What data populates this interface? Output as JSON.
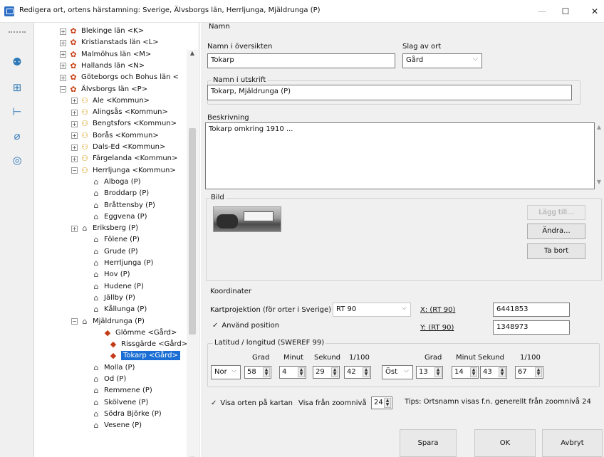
{
  "window": {
    "title": "Redigera ort, ortens härstamning: Sverige, Älvsborgs län, Herrljunga, Mjäldrunga (P)",
    "minimize_glyph": "—",
    "maximize_glyph": "☐",
    "close_glyph": "✕"
  },
  "toolbar": {
    "icons": [
      "people-icon",
      "tree-structure-icon",
      "hierarchy-icon",
      "filter-icon",
      "location-target-icon"
    ]
  },
  "tree": {
    "rows": [
      {
        "label": "Blekinge län <K>",
        "expander": "+",
        "icon": "✿"
      },
      {
        "label": "Kristianstads län <L>",
        "expander": "+",
        "icon": "✿"
      },
      {
        "label": "Malmöhus län <M>",
        "expander": "+",
        "icon": "✿"
      },
      {
        "label": "Hallands län <N>",
        "expander": "+",
        "icon": "✿"
      },
      {
        "label": "Göteborgs och Bohus län <",
        "expander": "+",
        "icon": "✿"
      },
      {
        "label": "Älvsborgs län <P>",
        "expander": "−",
        "icon": "✿"
      },
      {
        "label": "Ale <Kommun>",
        "expander": "+",
        "icon": "⚇"
      },
      {
        "label": "Alingsås <Kommun>",
        "expander": "+",
        "icon": "⚇"
      },
      {
        "label": "Bengtsfors <Kommun>",
        "expander": "+",
        "icon": "⚇"
      },
      {
        "label": "Borås <Kommun>",
        "expander": "+",
        "icon": "⚇"
      },
      {
        "label": "Dals-Ed <Kommun>",
        "expander": "+",
        "icon": "⚇"
      },
      {
        "label": "Färgelanda <Kommun>",
        "expander": "+",
        "icon": "⚇"
      },
      {
        "label": "Herrljunga <Kommun>",
        "expander": "−",
        "icon": "⚇"
      },
      {
        "label": "Alboga (P)",
        "expander": "",
        "icon": "⌂"
      },
      {
        "label": "Broddarp (P)",
        "expander": "",
        "icon": "⌂"
      },
      {
        "label": "Bråttensby (P)",
        "expander": "",
        "icon": "⌂"
      },
      {
        "label": "Eggvena (P)",
        "expander": "",
        "icon": "⌂"
      },
      {
        "label": "Eriksberg (P)",
        "expander": "+",
        "icon": "⌂"
      },
      {
        "label": "Fölene (P)",
        "expander": "",
        "icon": "⌂"
      },
      {
        "label": "Grude (P)",
        "expander": "",
        "icon": "⌂"
      },
      {
        "label": "Herrljunga (P)",
        "expander": "",
        "icon": "⌂"
      },
      {
        "label": "Hov (P)",
        "expander": "",
        "icon": "⌂"
      },
      {
        "label": "Hudene (P)",
        "expander": "",
        "icon": "⌂"
      },
      {
        "label": "Jällby (P)",
        "expander": "",
        "icon": "⌂"
      },
      {
        "label": "Kållunga (P)",
        "expander": "",
        "icon": "⌂"
      },
      {
        "label": "Mjäldrunga (P)",
        "expander": "−",
        "icon": "⌂"
      },
      {
        "label": "Glömme <Gård>",
        "expander": "",
        "icon": "◆"
      },
      {
        "label": "Rissgärde <Gård>",
        "expander": "",
        "icon": "◆"
      },
      {
        "label": "Tokarp <Gård>",
        "expander": "",
        "icon": "◆"
      },
      {
        "label": "Molla (P)",
        "expander": "",
        "icon": "⌂"
      },
      {
        "label": "Od (P)",
        "expander": "",
        "icon": "⌂"
      },
      {
        "label": "Remmene (P)",
        "expander": "",
        "icon": "⌂"
      },
      {
        "label": "Skölvene (P)",
        "expander": "",
        "icon": "⌂"
      },
      {
        "label": "Södra Björke (P)",
        "expander": "",
        "icon": "⌂"
      },
      {
        "label": "Vesene (P)",
        "expander": "",
        "icon": "⌂"
      }
    ],
    "scroll_up": "▲",
    "scroll_down": "▼",
    "scroll_left": "<",
    "scroll_right": ">"
  },
  "namn": {
    "group_label": "Namn",
    "oversikt_label": "Namn i översikten",
    "oversikt_value": "Tokarp",
    "slag_label": "Slag av ort",
    "slag_value": "Gård",
    "utskrift_label": "Namn i utskrift",
    "utskrift_value": "Tokarp, Mjäldrunga (P)"
  },
  "beskrivning": {
    "label": "Beskrivning",
    "value": "Tokarp omkring 1910 ..."
  },
  "bild": {
    "label": "Bild",
    "add_button": "Lägg till...",
    "change_button": "Ändra...",
    "remove_button": "Ta bort"
  },
  "koordinater": {
    "label": "Koordinater",
    "projection_label": "Kartprojektion (för orter i Sverige)",
    "projection_value": "RT 90",
    "use_position_mark": "✓",
    "use_position_label": "Använd position",
    "x_label": "X: (RT 90)",
    "x_value": "6441853",
    "y_label": "Y: (RT 90)",
    "y_value": "1348973",
    "latlong_label": "Latitud / longitud (SWEREF 99)",
    "headers_lat": [
      "Grad",
      "Minut",
      "Sekund",
      "1/100"
    ],
    "headers_lon": [
      "Grad",
      "Minut",
      "Sekund",
      "1/100"
    ],
    "lat_dir": "Nor",
    "lat_grad": "58",
    "lat_minut": "4",
    "lat_sekund": "29",
    "lat_hundra": "42",
    "lon_dir": "Öst",
    "lon_grad": "13",
    "lon_minut": "14",
    "lon_sekund": "43",
    "lon_hundra": "67"
  },
  "karta": {
    "show_mark": "✓",
    "show_label": "Visa orten på kartan",
    "zoom_label": "Visa från zoomnivå",
    "zoom_value": "24",
    "tip": "Tips: Ortsnamn visas f.n. generellt från zoomnivå 24"
  },
  "buttons": {
    "save": "Spara",
    "ok": "OK",
    "cancel": "Avbryt"
  }
}
